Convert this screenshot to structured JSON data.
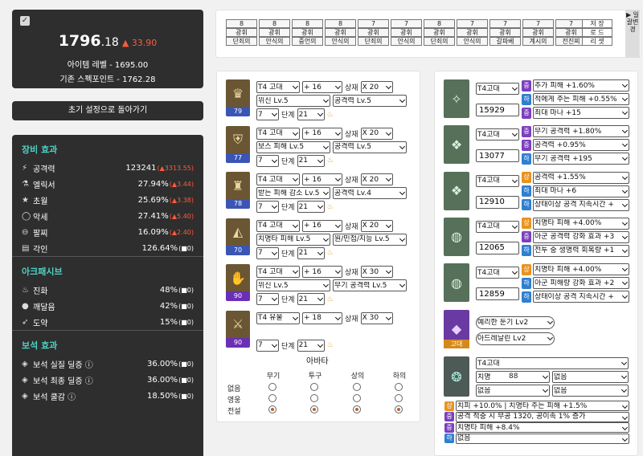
{
  "summary": {
    "score_int": "1796",
    "score_dec": ".18",
    "score_delta": "▲ 33.90",
    "item_level": "아이템 레벨 - 1695.00",
    "spec_points": "기존 스펙포인트 - 1762.28",
    "checkbox": "✓"
  },
  "reset_label": "초기 설정으로 돌아가기",
  "effects": {
    "equip_title": "장비 효과",
    "equip": [
      {
        "icon": "⚡",
        "name": "공격력",
        "value": "123241",
        "delta": "(▲3313.55)"
      },
      {
        "icon": "⚗",
        "name": "엘릭서",
        "value": "27.94%",
        "delta": "(▲3.44)"
      },
      {
        "icon": "★",
        "name": "초월",
        "value": "25.69%",
        "delta": "(▲3.38)"
      },
      {
        "icon": "◯",
        "name": "악세",
        "value": "27.41%",
        "delta": "(▲5.40)"
      },
      {
        "icon": "⊖",
        "name": "팔찌",
        "value": "16.09%",
        "delta": "(▲2.40)"
      },
      {
        "icon": "▤",
        "name": "각인",
        "value": "126.64%",
        "delta": "(■0)"
      }
    ],
    "ark_title": "아크패시브",
    "ark": [
      {
        "icon": "♨",
        "name": "진화",
        "value": "48%",
        "delta": "(■0)"
      },
      {
        "icon": "●",
        "name": "깨달음",
        "value": "42%",
        "delta": "(■0)"
      },
      {
        "icon": "➶",
        "name": "도약",
        "value": "15%",
        "delta": "(■0)"
      }
    ],
    "gem_title": "보석 효과",
    "gems": [
      {
        "icon": "◈",
        "name": "보석 실질 딜증 ⓘ",
        "value": "36.00%",
        "delta": "(■0)"
      },
      {
        "icon": "◈",
        "name": "보석 최종 딜증 ⓘ",
        "value": "36.00%",
        "delta": "(■0)"
      },
      {
        "icon": "◈",
        "name": "보석 쿨감 ⓘ",
        "value": "18.50%",
        "delta": "(■0)"
      }
    ]
  },
  "engrave_groups": [
    {
      "lvl": "8",
      "kind": "광휘",
      "name": "단죄의"
    },
    {
      "lvl": "8",
      "kind": "광휘",
      "name": "안식의"
    },
    {
      "lvl": "8",
      "kind": "광휘",
      "name": "중언의"
    },
    {
      "lvl": "8",
      "kind": "광휘",
      "name": "안식의"
    },
    {
      "lvl": "7",
      "kind": "광휘",
      "name": "단죄의"
    },
    {
      "lvl": "7",
      "kind": "광휘",
      "name": "안식의"
    },
    {
      "lvl": "8",
      "kind": "광휘",
      "name": "단죄의"
    },
    {
      "lvl": "7",
      "kind": "광휘",
      "name": "안식의"
    },
    {
      "lvl": "7",
      "kind": "광휘",
      "name": "갈파베"
    },
    {
      "lvl": "7",
      "kind": "광휘",
      "name": "계시의"
    },
    {
      "lvl": "7",
      "kind": "광휘",
      "name": "전진찌"
    }
  ],
  "save_box": {
    "a": "저 장",
    "b": "로 드",
    "c": "리 셋"
  },
  "side_toggle": "▶ 일괄변경",
  "gear": [
    {
      "grade": "79",
      "tier": "T4 고대",
      "up": "+ 16",
      "sang": "상재",
      "mult": "X 20",
      "opt1": "위신 Lv.5",
      "opt2": "공격력 Lv.5",
      "tr": "7",
      "dan": "단계",
      "dv": "21"
    },
    {
      "grade": "77",
      "tier": "T4 고대",
      "up": "+ 16",
      "sang": "상재",
      "mult": "X 20",
      "opt1": "보스 피해 Lv.5",
      "opt2": "공격력 Lv.5",
      "tr": "7",
      "dan": "단계",
      "dv": "21"
    },
    {
      "grade": "78",
      "tier": "T4 고대",
      "up": "+ 16",
      "sang": "상재",
      "mult": "X 20",
      "opt1": "받는 피해 감소 Lv.5",
      "opt2": "공격력 Lv.4",
      "tr": "7",
      "dan": "단계",
      "dv": "21"
    },
    {
      "grade": "70",
      "tier": "T4 고대",
      "up": "+ 16",
      "sang": "상재",
      "mult": "X 20",
      "opt1": "치명타 피해 Lv.5",
      "opt2": "원/민첩/지능 Lv.5",
      "tr": "7",
      "dan": "단계",
      "dv": "21"
    },
    {
      "grade": "90",
      "tier": "T4 고대",
      "up": "+ 16",
      "sang": "상재",
      "mult": "X 30",
      "opt1": "위신 Lv.5",
      "opt2": "무기 공격력 Lv.5",
      "tr": "7",
      "dan": "단계",
      "dv": "21"
    },
    {
      "grade": "90",
      "tier": "T4 유물",
      "up": "+ 18",
      "sang": "상재",
      "mult": "X 30",
      "opt1": "",
      "opt2": "",
      "tr": "7",
      "dan": "단계",
      "dv": "21"
    }
  ],
  "abata": {
    "title": "아바타",
    "cols": [
      "무기",
      "투구",
      "상의",
      "하의"
    ],
    "rows": [
      "없음",
      "영웅",
      "전설"
    ],
    "selected": 2
  },
  "accessories": [
    {
      "tier": "T4고대",
      "val": "15929",
      "stats": [
        {
          "t": "중",
          "c": "p",
          "v": "추가 피해 +1.60%"
        },
        {
          "t": "하",
          "c": "b",
          "v": "적에게 주는 피해 +0.55%"
        },
        {
          "t": "중",
          "c": "p",
          "v": "최대 마나 +15"
        }
      ]
    },
    {
      "tier": "T4고대",
      "val": "13077",
      "stats": [
        {
          "t": "중",
          "c": "p",
          "v": "무기 공격력 +1.80%"
        },
        {
          "t": "중",
          "c": "p",
          "v": "공격력 +0.95%"
        },
        {
          "t": "하",
          "c": "b",
          "v": "무기 공격력 +195"
        }
      ]
    },
    {
      "tier": "T4고대",
      "val": "12910",
      "stats": [
        {
          "t": "상",
          "c": "o",
          "v": "공격력 +1.55%"
        },
        {
          "t": "하",
          "c": "b",
          "v": "최대 마나 +6"
        },
        {
          "t": "하",
          "c": "b",
          "v": "상태이상 공격 지속시간 +"
        }
      ]
    },
    {
      "tier": "T4고대",
      "val": "12065",
      "stats": [
        {
          "t": "상",
          "c": "o",
          "v": "치명타 피해 +4.00%"
        },
        {
          "t": "중",
          "c": "p",
          "v": "아군 공격력 강화 효과 +3"
        },
        {
          "t": "하",
          "c": "b",
          "v": "전투 중 생명력 회복량 +1"
        }
      ]
    },
    {
      "tier": "T4고대",
      "val": "12859",
      "stats": [
        {
          "t": "상",
          "c": "o",
          "v": "치명타 피해 +4.00%"
        },
        {
          "t": "하",
          "c": "b",
          "v": "아군 피해량 강화 효과 +2"
        },
        {
          "t": "하",
          "c": "b",
          "v": "상태이상 공격 지속시간 +"
        }
      ]
    }
  ],
  "stone": {
    "label": "고대",
    "opt1": "예리한 둔기 Lv2",
    "opt2": "아드레날린 Lv2"
  },
  "bracelet": {
    "tier": "T4고대",
    "c1": "치명",
    "c1v": "88",
    "c2": "없음",
    "c3": "없음",
    "c4": "없음",
    "effects": [
      {
        "t": "상",
        "c": "o",
        "v": "치피 +10.0% | 치명타 주는 피해 +1.5%"
      },
      {
        "t": "중",
        "c": "p",
        "v": "공격 적중 시 무공 1320, 공이속 1% 증가"
      },
      {
        "t": "중",
        "c": "p",
        "v": "치명타 피해 +8.4%"
      },
      {
        "t": "하",
        "c": "b",
        "v": "없음"
      }
    ]
  }
}
